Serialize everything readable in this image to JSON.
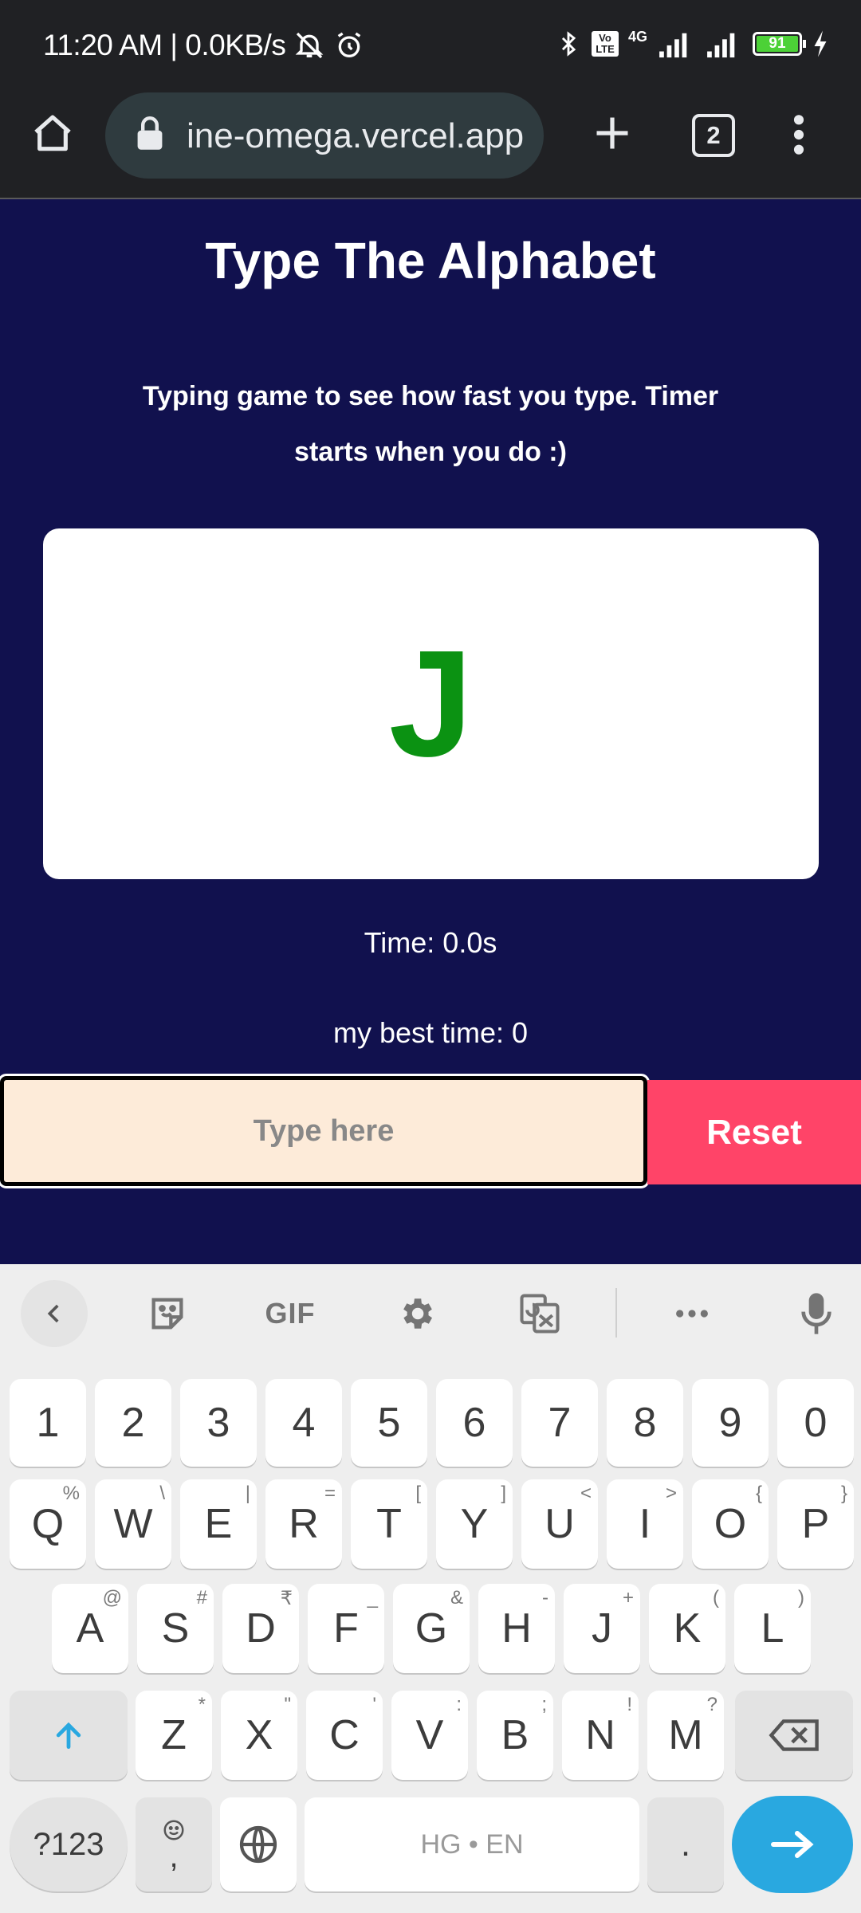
{
  "status_bar": {
    "time_speed": "11:20 AM | 0.0KB/s",
    "network": "4G",
    "volte": "Vo LTE",
    "battery": "91"
  },
  "browser": {
    "url": "ine-omega.vercel.app",
    "tab_count": "2"
  },
  "page": {
    "title": "Type The Alphabet",
    "description": "Typing game to see how fast you type. Timer starts when you do :)",
    "current_letter": "J",
    "timer": "Time: 0.0s",
    "best_time": "my best time: 0",
    "input_placeholder": "Type here",
    "reset_label": "Reset"
  },
  "keyboard": {
    "gif_label": "GIF",
    "row_numbers": [
      "1",
      "2",
      "3",
      "4",
      "5",
      "6",
      "7",
      "8",
      "9",
      "0"
    ],
    "row_top": [
      {
        "k": "Q",
        "h": "%"
      },
      {
        "k": "W",
        "h": "\\"
      },
      {
        "k": "E",
        "h": "|"
      },
      {
        "k": "R",
        "h": "="
      },
      {
        "k": "T",
        "h": "["
      },
      {
        "k": "Y",
        "h": "]"
      },
      {
        "k": "U",
        "h": "<"
      },
      {
        "k": "I",
        "h": ">"
      },
      {
        "k": "O",
        "h": "{"
      },
      {
        "k": "P",
        "h": "}"
      }
    ],
    "row_mid": [
      {
        "k": "A",
        "h": "@"
      },
      {
        "k": "S",
        "h": "#"
      },
      {
        "k": "D",
        "h": "₹"
      },
      {
        "k": "F",
        "h": "_"
      },
      {
        "k": "G",
        "h": "&"
      },
      {
        "k": "H",
        "h": "-"
      },
      {
        "k": "J",
        "h": "+"
      },
      {
        "k": "K",
        "h": "("
      },
      {
        "k": "L",
        "h": ")"
      }
    ],
    "row_bottom": [
      {
        "k": "Z",
        "h": "*"
      },
      {
        "k": "X",
        "h": "\""
      },
      {
        "k": "C",
        "h": "'"
      },
      {
        "k": "V",
        "h": ":"
      },
      {
        "k": "B",
        "h": ";"
      },
      {
        "k": "N",
        "h": "!"
      },
      {
        "k": "M",
        "h": "?"
      }
    ],
    "symbols_label": "?123",
    "comma_label": ",",
    "space_label": "HG • EN",
    "period_label": ".",
    "accent_color": "#29a8e0"
  }
}
